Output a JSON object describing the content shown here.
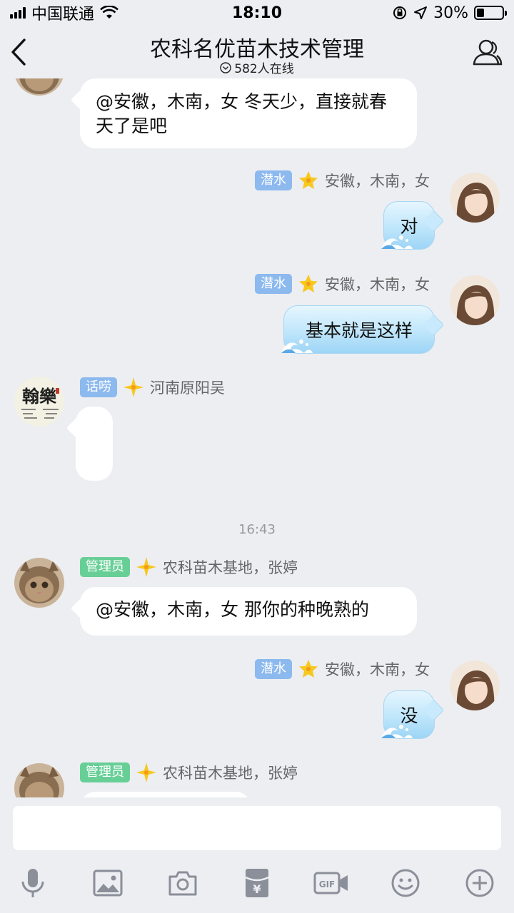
{
  "status_bar": {
    "carrier": "中国联通",
    "time": "18:10",
    "battery": "30%",
    "battery_level": 0.3
  },
  "nav": {
    "title": "农科名优苗木技术管理",
    "online": "582人在线"
  },
  "messages": [
    {
      "id": "m1",
      "side": "left",
      "text": "@安徽，木南，女 冬天少，直接就春天了是吧"
    },
    {
      "id": "m2",
      "side": "right",
      "badge": "潜水",
      "sender": "安徽，木南，女",
      "text": "对"
    },
    {
      "id": "m3",
      "side": "right",
      "badge": "潜水",
      "sender": "安徽，木南，女",
      "text": "基本就是这样"
    },
    {
      "id": "m4",
      "side": "left",
      "badge": "话唠",
      "sender": "河南原阳吴",
      "text": ""
    },
    {
      "id": "m5",
      "side": "left",
      "badge": "管理员",
      "sender": "农科苗木基地，张婷",
      "text": "@安徽，木南，女 那你的种晚熟的"
    },
    {
      "id": "m6",
      "side": "right",
      "badge": "潜水",
      "sender": "安徽，木南，女",
      "text": "没"
    },
    {
      "id": "m7",
      "side": "left",
      "badge": "管理员",
      "sender": "农科苗木基地，张婷",
      "text": ""
    }
  ],
  "timestamp": "16:43",
  "avatar_calligraphy_text": "翰樂",
  "toolbar": {
    "icons": [
      "microphone-icon",
      "image-icon",
      "camera-icon",
      "red-packet-icon",
      "gif-icon",
      "emoji-icon",
      "plus-icon"
    ],
    "gif_label": "GIF",
    "yen_label": "¥"
  },
  "colors": {
    "background": "#eceef2",
    "badge_blue": "#8cb9ee",
    "badge_green": "#67cf96",
    "bubble_right": "#bfe6fb",
    "icon_gray": "#8a8f99"
  }
}
